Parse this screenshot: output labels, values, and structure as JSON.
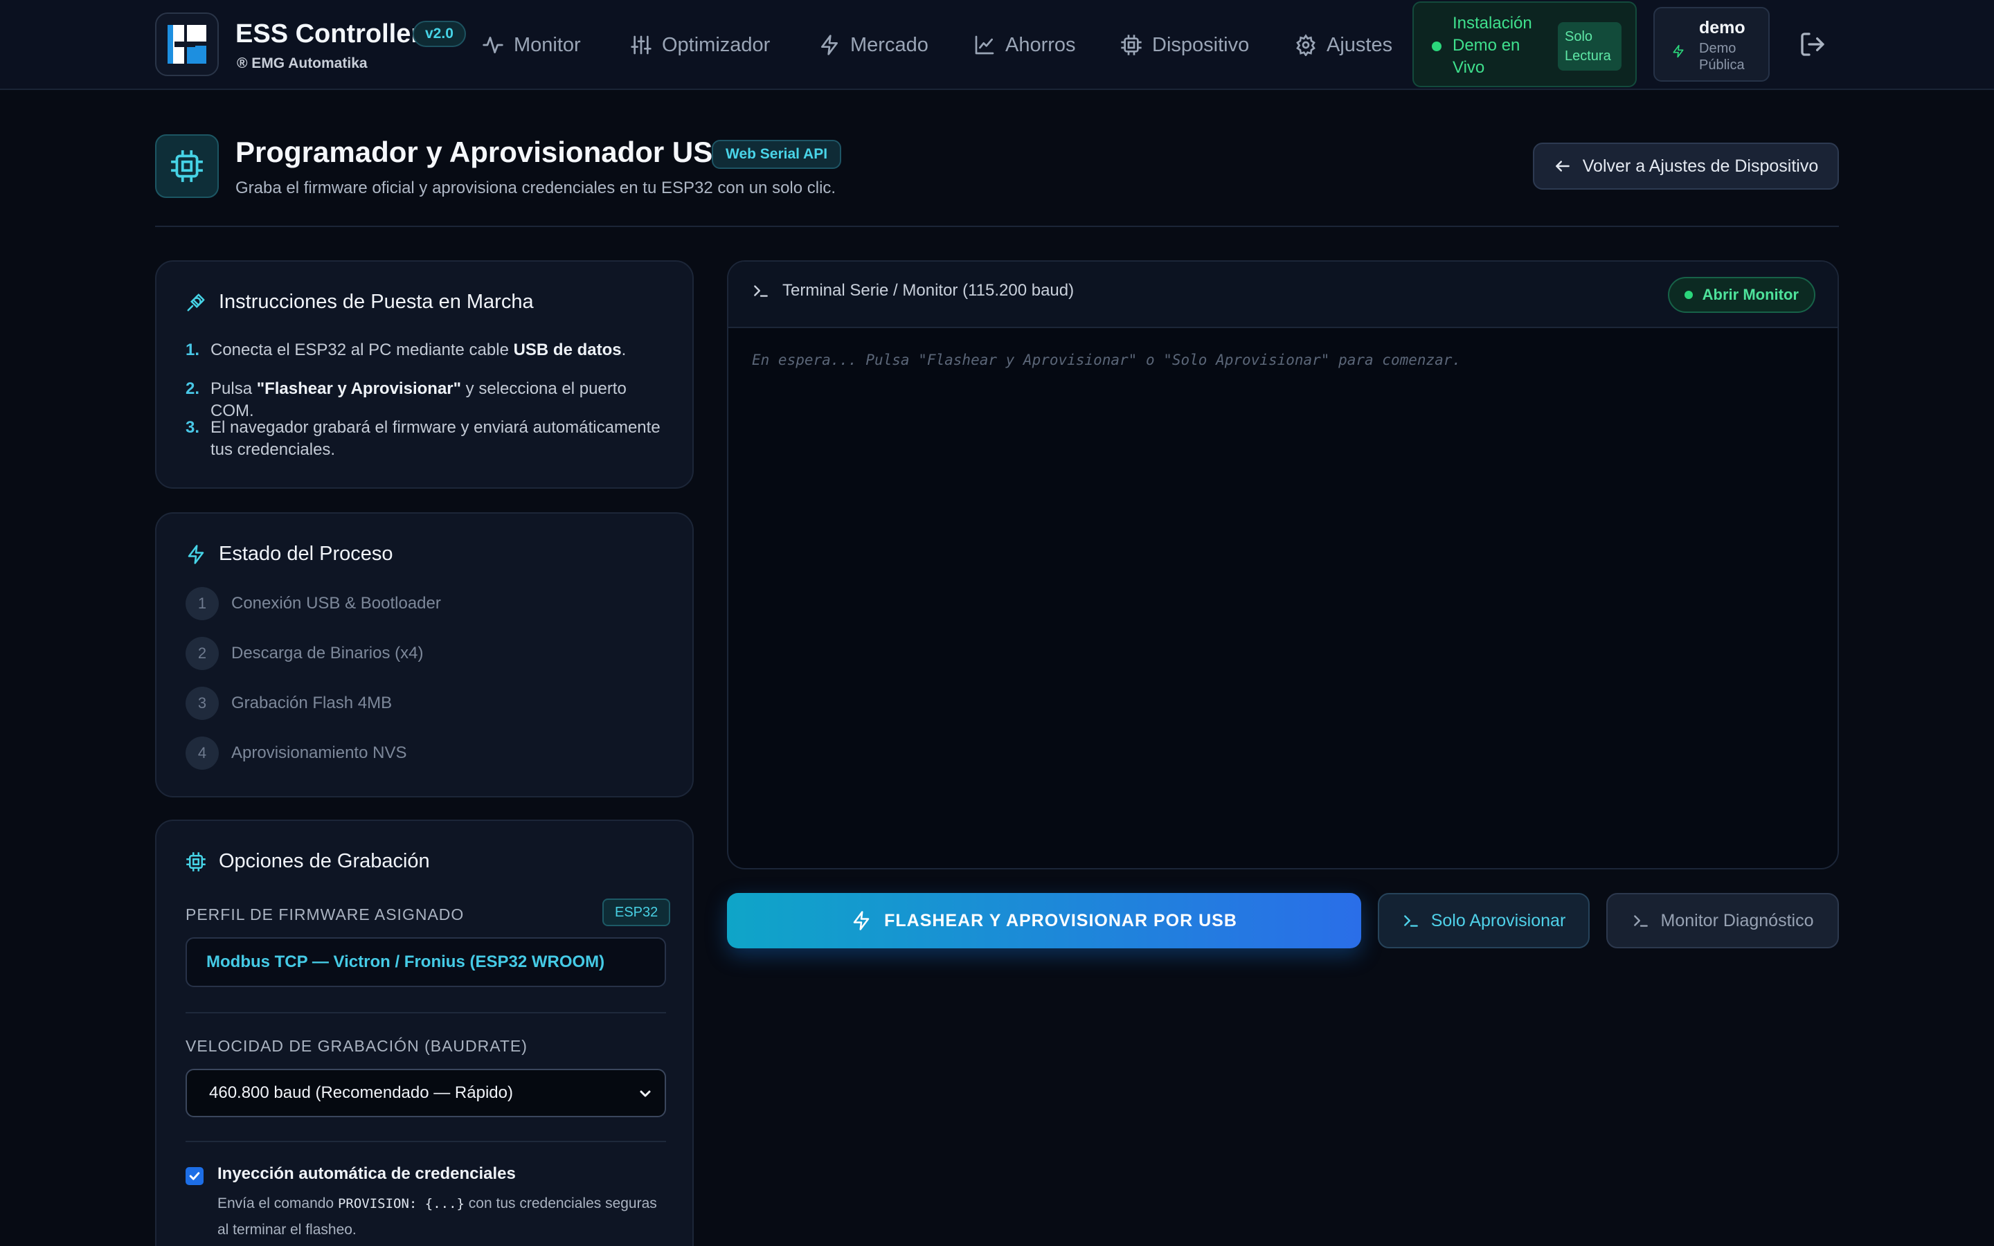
{
  "colors": {
    "background": "#070b14",
    "accent_cyan": "#46d3e6",
    "accent_green": "#2bd67b",
    "primary_gradient": [
      "#0fa5c8",
      "#2a6ee8"
    ]
  },
  "brand": {
    "title": "ESS Controller",
    "version": "v2.0",
    "subtitle": "® EMG Automatika"
  },
  "nav": {
    "items": [
      {
        "label": "Monitor",
        "icon": "activity-icon"
      },
      {
        "label": "Optimizador",
        "icon": "sliders-icon"
      },
      {
        "label": "Mercado",
        "icon": "bolt-icon"
      },
      {
        "label": "Ahorros",
        "icon": "trend-chart-icon"
      },
      {
        "label": "Dispositivo",
        "icon": "chip-icon"
      },
      {
        "label": "Ajustes",
        "icon": "gear-icon"
      }
    ]
  },
  "install_status": {
    "label": "Instalación Demo en Vivo",
    "badge": "Solo Lectura"
  },
  "user": {
    "name": "demo",
    "role": "Demo Pública"
  },
  "page": {
    "title": "Programador y Aprovisionador USB",
    "api_badge": "Web Serial API",
    "subtitle": "Graba el firmware oficial y aprovisiona credenciales en tu ESP32 con un solo clic.",
    "back_button": "Volver a Ajustes de Dispositivo"
  },
  "instructions": {
    "title": "Instrucciones de Puesta en Marcha",
    "steps": [
      {
        "num": "1.",
        "pre": "Conecta el ESP32 al PC mediante cable ",
        "bold": "USB de datos",
        "post": "."
      },
      {
        "num": "2.",
        "pre": "Pulsa ",
        "bold": "\"Flashear y Aprovisionar\"",
        "post": " y selecciona el puerto COM."
      },
      {
        "num": "3.",
        "pre": "El navegador grabará el firmware y enviará automáticamente tus credenciales.",
        "bold": "",
        "post": ""
      }
    ]
  },
  "process": {
    "title": "Estado del Proceso",
    "steps": [
      {
        "num": "1",
        "label": "Conexión USB & Bootloader"
      },
      {
        "num": "2",
        "label": "Descarga de Binarios (x4)"
      },
      {
        "num": "3",
        "label": "Grabación Flash 4MB"
      },
      {
        "num": "4",
        "label": "Aprovisionamiento NVS"
      }
    ]
  },
  "options": {
    "title": "Opciones de Grabación",
    "profile_label": "PERFIL DE FIRMWARE ASIGNADO",
    "profile_badge": "ESP32",
    "profile_value": "Modbus TCP — Victron / Fronius (ESP32 WROOM)",
    "baud_label": "VELOCIDAD DE GRABACIÓN (BAUDRATE)",
    "baud_value": "460.800 baud (Recomendado — Rápido)",
    "auto_inject_checked": true,
    "auto_inject_label": "Inyección automática de credenciales",
    "auto_inject_desc_pre": "Envía el comando ",
    "auto_inject_desc_code": "PROVISION: {...}",
    "auto_inject_desc_post": " con tus credenciales seguras al terminar el flasheo."
  },
  "terminal": {
    "title": "Terminal Serie / Monitor (115.200 baud)",
    "open_button": "Abrir Monitor",
    "placeholder": "En espera... Pulsa \"Flashear y Aprovisionar\" o \"Solo Aprovisionar\" para comenzar."
  },
  "actions": {
    "flash": "FLASHEAR Y APROVISIONAR POR USB",
    "provision_only": "Solo Aprovisionar",
    "diagnostic": "Monitor Diagnóstico"
  }
}
